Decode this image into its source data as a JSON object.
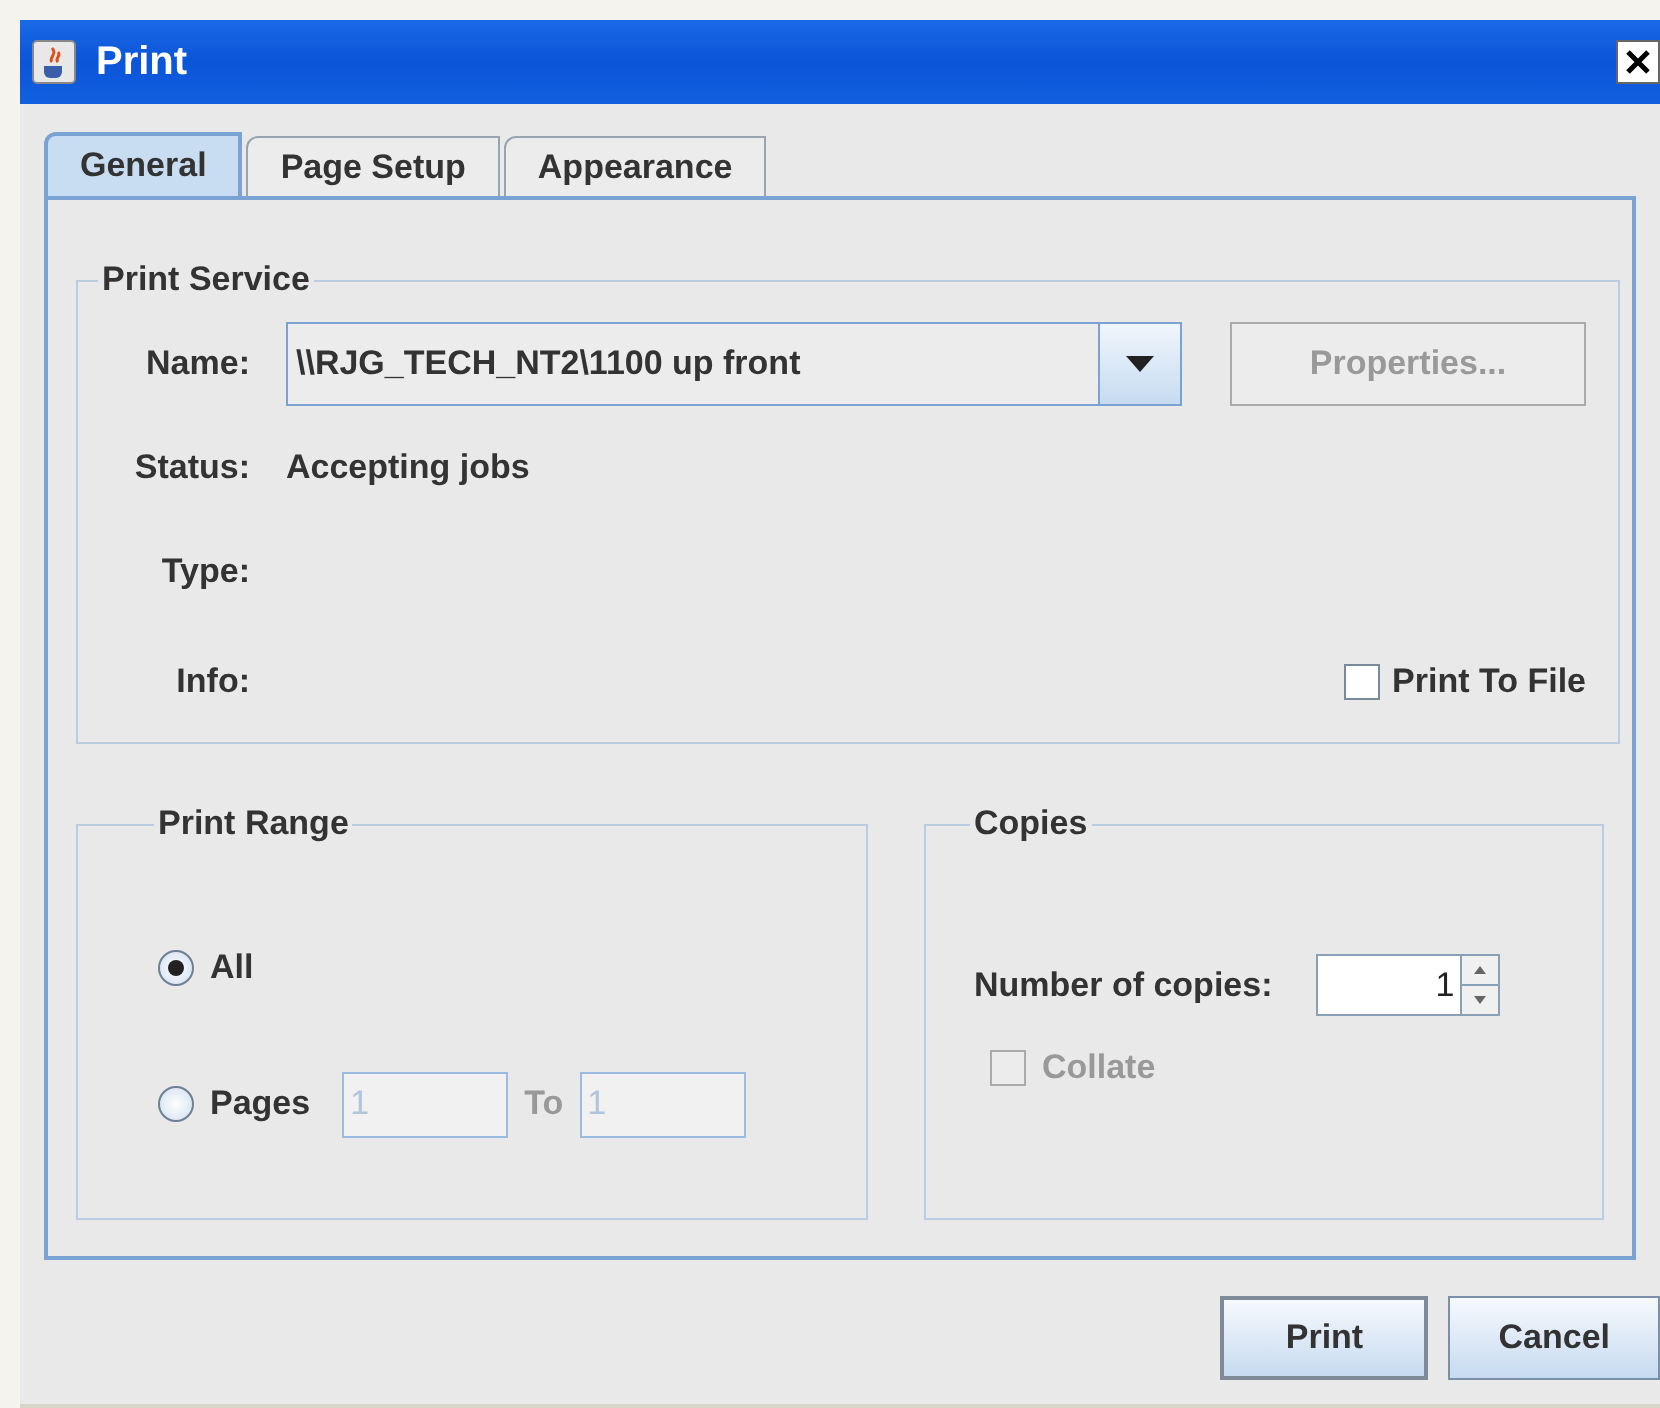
{
  "window": {
    "title": "Print"
  },
  "tabs": [
    {
      "label": "General",
      "selected": true
    },
    {
      "label": "Page Setup",
      "selected": false
    },
    {
      "label": "Appearance",
      "selected": false
    }
  ],
  "print_service": {
    "title": "Print Service",
    "name_label": "Name:",
    "printer": "\\\\RJG_TECH_NT2\\1100 up front",
    "properties_button": {
      "label": "Properties...",
      "disabled": true
    },
    "status_label": "Status:",
    "status": "Accepting jobs",
    "type_label": "Type:",
    "info_label": "Info:",
    "print_to_file": {
      "label": "Print To File",
      "checked": false
    }
  },
  "print_range": {
    "title": "Print Range",
    "options": [
      {
        "label": "All",
        "selected": true
      },
      {
        "label": "Pages",
        "selected": false
      }
    ],
    "from": "1",
    "to_label": "To",
    "to": "1",
    "fields_disabled": true
  },
  "copies": {
    "title": "Copies",
    "label": "Number of copies:",
    "value": "1",
    "collate": {
      "label": "Collate",
      "checked": false,
      "disabled": true
    }
  },
  "buttons": [
    {
      "label": "Print",
      "default": true
    },
    {
      "label": "Cancel",
      "default": false
    }
  ]
}
